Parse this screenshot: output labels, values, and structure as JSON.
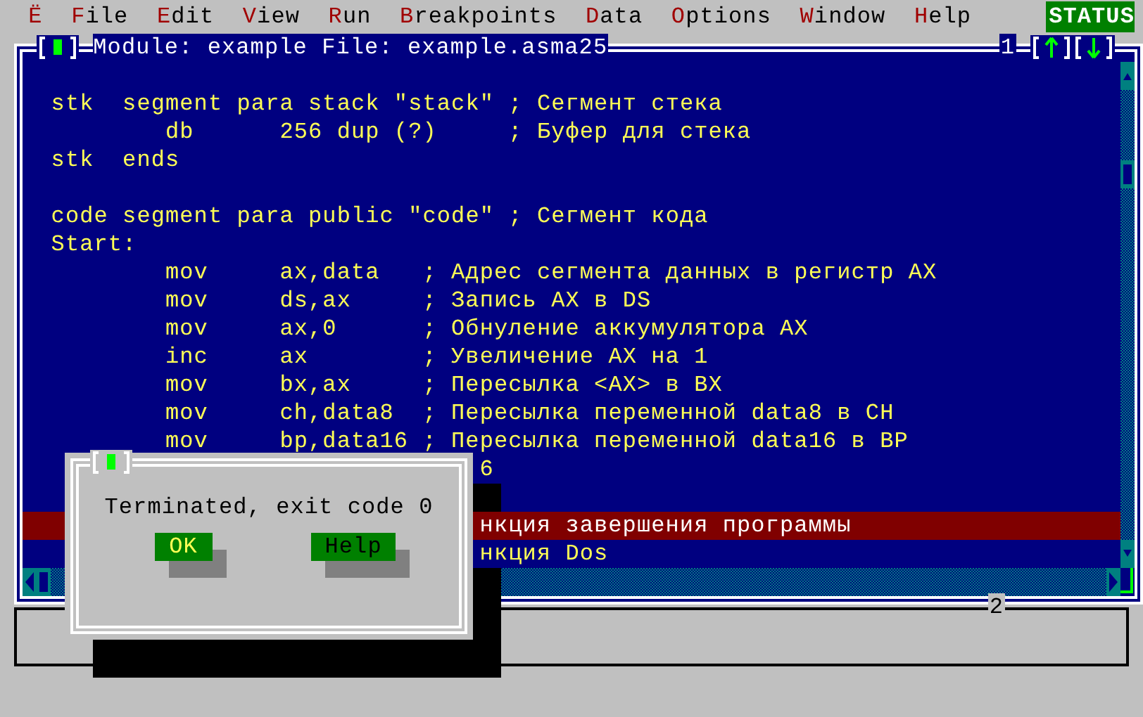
{
  "menu": [
    {
      "hotkey": "Ë"
    },
    {
      "hotkey": "F",
      "rest": "ile"
    },
    {
      "hotkey": "E",
      "rest": "dit"
    },
    {
      "hotkey": "V",
      "rest": "iew"
    },
    {
      "hotkey": "R",
      "rest": "un"
    },
    {
      "hotkey": "B",
      "rest": "reakpoints"
    },
    {
      "hotkey": "D",
      "rest": "ata"
    },
    {
      "hotkey": "O",
      "rest": "ptions"
    },
    {
      "hotkey": "W",
      "rest": "indow"
    },
    {
      "hotkey": "H",
      "rest": "elp"
    }
  ],
  "status": "STATUS",
  "module_window": {
    "title": "Module: example File: example.asma25",
    "number": "1",
    "lines": [
      {
        "kind": "code",
        "text": "  stk  segment para stack \"stack\" ; Сегмент стека",
        "highlighted": false
      },
      {
        "kind": "code",
        "text": "          db      256 dup (?)     ; Буфер для стека",
        "highlighted": false
      },
      {
        "kind": "code",
        "text": "  stk  ends",
        "highlighted": false
      },
      {
        "kind": "blank",
        "highlighted": false
      },
      {
        "kind": "code",
        "text": "  code segment para public \"code\" ; Сегмент кода",
        "highlighted": false
      },
      {
        "kind": "code",
        "text": "  Start:",
        "highlighted": false
      },
      {
        "kind": "code",
        "text": "          mov     ax,data   ; Адрес сегмента данных в регистр AX",
        "highlighted": false
      },
      {
        "kind": "code",
        "text": "          mov     ds,ax     ; Запись AX в DS",
        "highlighted": false
      },
      {
        "kind": "code",
        "text": "          mov     ax,0      ; Обнуление аккумулятора AX",
        "highlighted": false
      },
      {
        "kind": "code",
        "text": "          inc     ax        ; Увеличение AX на 1",
        "highlighted": false
      },
      {
        "kind": "code",
        "text": "          mov     bx,ax     ; Пересылка <AX> в BX",
        "highlighted": false
      },
      {
        "kind": "code",
        "text": "          mov     ch,data8  ; Пересылка переменной data8 в CH",
        "highlighted": false
      },
      {
        "kind": "code",
        "text": "          mov     bp,data16 ; Пересылка переменной data16 в BP",
        "highlighted": false
      },
      {
        "kind": "code",
        "text": "                                6",
        "highlighted": false
      },
      {
        "kind": "blank",
        "highlighted": false
      },
      {
        "kind": "code",
        "text": "                                нкция завершения программы",
        "highlighted": true
      },
      {
        "kind": "code",
        "text": "                                нкция Dos",
        "highlighted": false
      }
    ]
  },
  "second_window": {
    "number": "2"
  },
  "dialog": {
    "message": "Terminated, exit code 0",
    "buttons": [
      {
        "label": "OK",
        "selected": true
      },
      {
        "label": "Help",
        "selected": false
      }
    ]
  }
}
